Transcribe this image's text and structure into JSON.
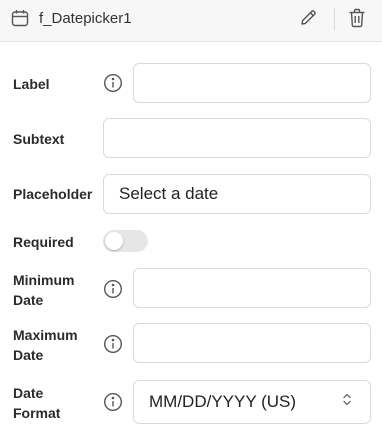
{
  "header": {
    "title": "f_Datepicker1",
    "icons": {
      "component": "calendar-icon",
      "edit": "pencil-icon",
      "delete": "trash-icon"
    }
  },
  "fields": {
    "label": {
      "label": "Label",
      "value": ""
    },
    "subtext": {
      "label": "Subtext",
      "value": ""
    },
    "placeholder": {
      "label": "Placeholder",
      "value": "Select a date"
    },
    "required": {
      "label": "Required",
      "checked": false
    },
    "min_date": {
      "label_line1": "Minimum",
      "label_line2": "Date",
      "value": ""
    },
    "max_date": {
      "label_line1": "Maximum",
      "label_line2": "Date",
      "value": ""
    },
    "date_format": {
      "label_line1": "Date",
      "label_line2": "Format",
      "selected": "MM/DD/YYYY (US)"
    }
  },
  "colors": {
    "header_bg": "#f7f7f7",
    "border": "#dadada",
    "toggle_off": "#e6e6e6",
    "icon": "#555555"
  }
}
